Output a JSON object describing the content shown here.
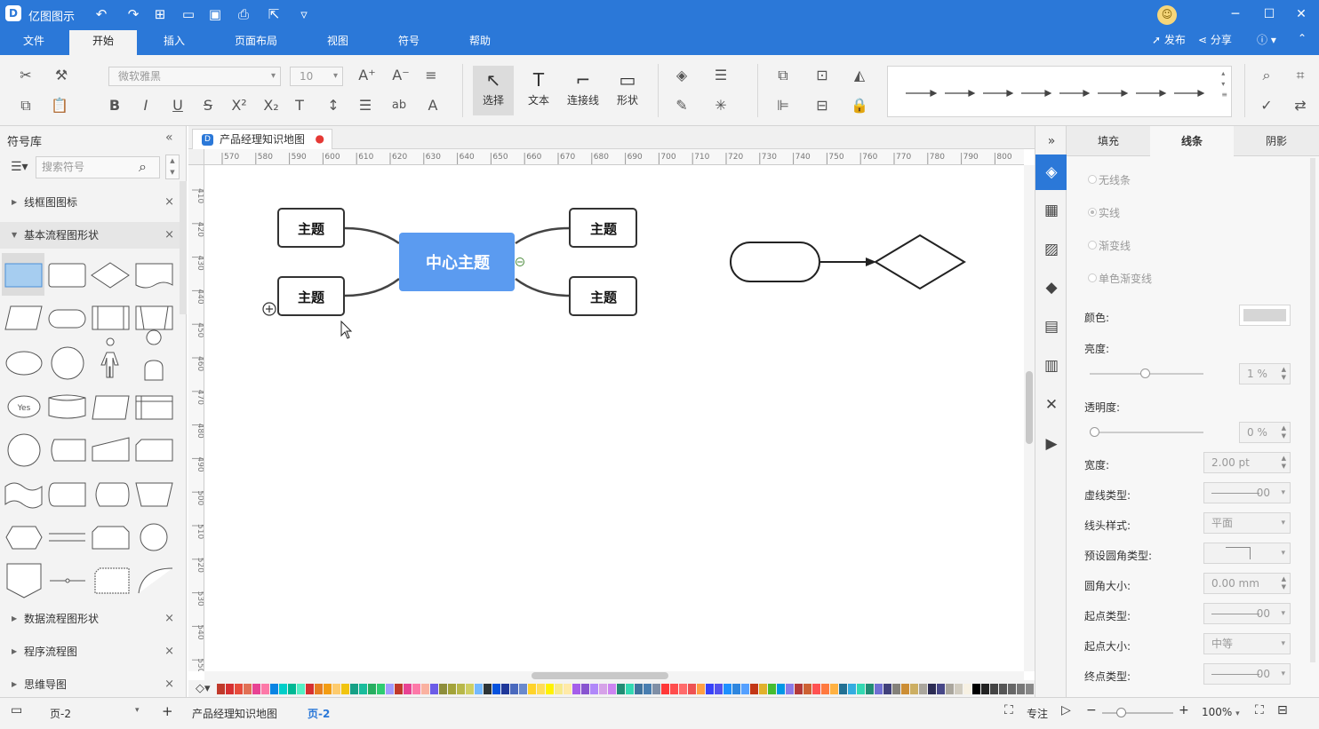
{
  "app": {
    "title": "亿图图示"
  },
  "menus": [
    "文件",
    "开始",
    "插入",
    "页面布局",
    "视图",
    "符号",
    "帮助"
  ],
  "header_right": {
    "publish": "发布",
    "share": "分享"
  },
  "ribbon": {
    "font_name": "微软雅黑",
    "font_size": "10",
    "tools": {
      "select": "选择",
      "text": "文本",
      "connector": "连接线",
      "shape": "形状"
    }
  },
  "left_panel": {
    "title": "符号库",
    "search_placeholder": "搜索符号",
    "categories": [
      "线框图图标",
      "基本流程图形状",
      "数据流程图形状",
      "程序流程图",
      "思维导图"
    ]
  },
  "document": {
    "tab": "产品经理知识地图"
  },
  "ruler": {
    "h": [
      "570",
      "580",
      "590",
      "600",
      "610",
      "620",
      "630",
      "640",
      "650",
      "660",
      "670",
      "680",
      "690",
      "700",
      "710",
      "720",
      "730",
      "740",
      "750",
      "760",
      "770",
      "780",
      "790",
      "800"
    ],
    "v": [
      "410",
      "420",
      "430",
      "440",
      "450",
      "460",
      "470",
      "480",
      "490",
      "500",
      "510",
      "520",
      "530",
      "540",
      "550"
    ]
  },
  "canvas": {
    "center_topic": "中心主题",
    "topics": [
      "主题",
      "主题",
      "主题",
      "主题"
    ]
  },
  "shape_small_text": {
    "yes": "Yes"
  },
  "right_panel": {
    "tabs": [
      "填充",
      "线条",
      "阴影"
    ],
    "line_options": [
      "无线条",
      "实线",
      "渐变线",
      "单色渐变线"
    ],
    "labels": {
      "color": "颜色:",
      "brightness": "亮度:",
      "transparency": "透明度:",
      "width": "宽度:",
      "dash_type": "虚线类型:",
      "cap_style": "线头样式:",
      "corner_type": "预设圆角类型:",
      "corner_size": "圆角大小:",
      "start_type": "起点类型:",
      "start_size": "起点大小:",
      "end_type": "终点类型:"
    },
    "values": {
      "brightness": "1 %",
      "transparency": "0 %",
      "width": "2.00 pt",
      "dash_type": "00",
      "cap_style": "平面",
      "corner_size": "0.00 mm",
      "start_type": "00",
      "start_size": "中等",
      "end_type": "00"
    },
    "slider_levels": {
      "brightness": 0.49,
      "transparency": 0.0
    }
  },
  "status": {
    "page_select": "页-2",
    "page_tabs": [
      "产品经理知识地图",
      "页-2"
    ],
    "focus": "专注",
    "zoom": "100%"
  },
  "colors": {
    "accent": "#2b78d8",
    "center_topic_fill": "#5b9bf0",
    "palette": [
      "#c0392b",
      "#d63031",
      "#e74c3c",
      "#e17055",
      "#e84393",
      "#fd79a8",
      "#0984e3",
      "#00cec9",
      "#00b894",
      "#55efc4",
      "#d63031",
      "#e67e22",
      "#f39c12",
      "#fdcb6e",
      "#f1c40f",
      "#16a085",
      "#1abc9c",
      "#27ae60",
      "#2ecc71",
      "#a29bfe",
      "#c0392b",
      "#e84393",
      "#fd79a8",
      "#fab1a0",
      "#6c5ce7",
      "#8e8e3c",
      "#a3a33a",
      "#b8b84a",
      "#cfcf63",
      "#74b9ff",
      "#2d3436",
      "#0652dd",
      "#1e3799",
      "#4a69bd",
      "#6a89cc",
      "#ffd32a",
      "#ffdd59",
      "#fff200",
      "#f7e98b",
      "#ffeaa7",
      "#a55eea",
      "#8854d0",
      "#b088f9",
      "#d6a2e8",
      "#cd84f1",
      "#218c74",
      "#33d9b2",
      "#40739e",
      "#487eb0",
      "#7f8fa6",
      "#ff3838",
      "#ff4d4d",
      "#ff6b6b",
      "#ee5253",
      "#ff9f43",
      "#3742fa",
      "#5352ed",
      "#1e90ff",
      "#2e86de",
      "#54a0ff",
      "#c23616",
      "#e1b12c",
      "#44bd32",
      "#0097e6",
      "#8c7ae6",
      "#b33939",
      "#cd6133",
      "#ff5252",
      "#ff793f",
      "#ffb142",
      "#227093",
      "#34ace0",
      "#33d9b2",
      "#218c74",
      "#706fd3",
      "#40407a",
      "#84817a",
      "#cc8e35",
      "#ccae62",
      "#aaa69d",
      "#2c2c54",
      "#474787",
      "#aaa69d",
      "#d1ccc0",
      "#f7f1e3",
      "#000000",
      "#222222",
      "#444444",
      "#555555",
      "#666666",
      "#777777",
      "#888888",
      "#999999",
      "#aaaaaa",
      "#bbbbbb",
      "#cccccc",
      "#dddddd",
      "#eeeeee",
      "#f5f5f5",
      "#ffffff"
    ]
  }
}
